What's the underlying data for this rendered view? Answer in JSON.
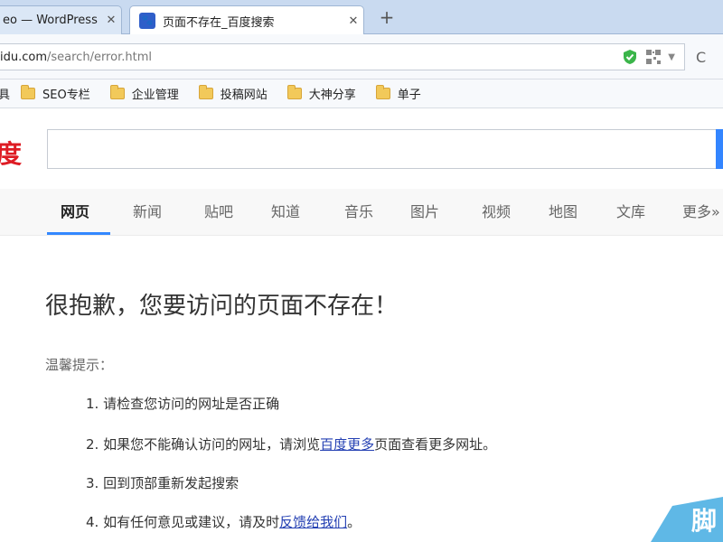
{
  "browser": {
    "tabs": [
      {
        "title": "eo — WordPress",
        "active": false
      },
      {
        "title": "页面不存在_百度搜索",
        "active": true
      }
    ],
    "new_tab": "+",
    "tab_close": "✕",
    "url_host": "idu.com",
    "url_path": "/search/error.html",
    "refresh_glyph": "C",
    "bookmarks": [
      "具",
      "SEO专栏",
      "企业管理",
      "投稿网站",
      "大神分享",
      "单子"
    ]
  },
  "baidu": {
    "logo_text": "度",
    "search_value": "",
    "brand_color": "#de1c24",
    "accent_color": "#3385ff",
    "nav": [
      "网页",
      "新闻",
      "贴吧",
      "知道",
      "音乐",
      "图片",
      "视频",
      "地图",
      "文库",
      "更多»"
    ]
  },
  "content": {
    "title": "很抱歉，您要访问的页面不存在！",
    "tip_label": "温馨提示：",
    "tips": [
      {
        "before": "1. 请检查您访问的网址是否正确",
        "link": "",
        "after": ""
      },
      {
        "before": "2. 如果您不能确认访问的网址，请浏览",
        "link": "百度更多",
        "after": "页面查看更多网址。"
      },
      {
        "before": "3. 回到顶部重新发起搜索",
        "link": "",
        "after": ""
      },
      {
        "before": "4. 如有任何意见或建议，请及时",
        "link": "反馈给我们",
        "after": "。"
      }
    ]
  },
  "watermark": "脚"
}
